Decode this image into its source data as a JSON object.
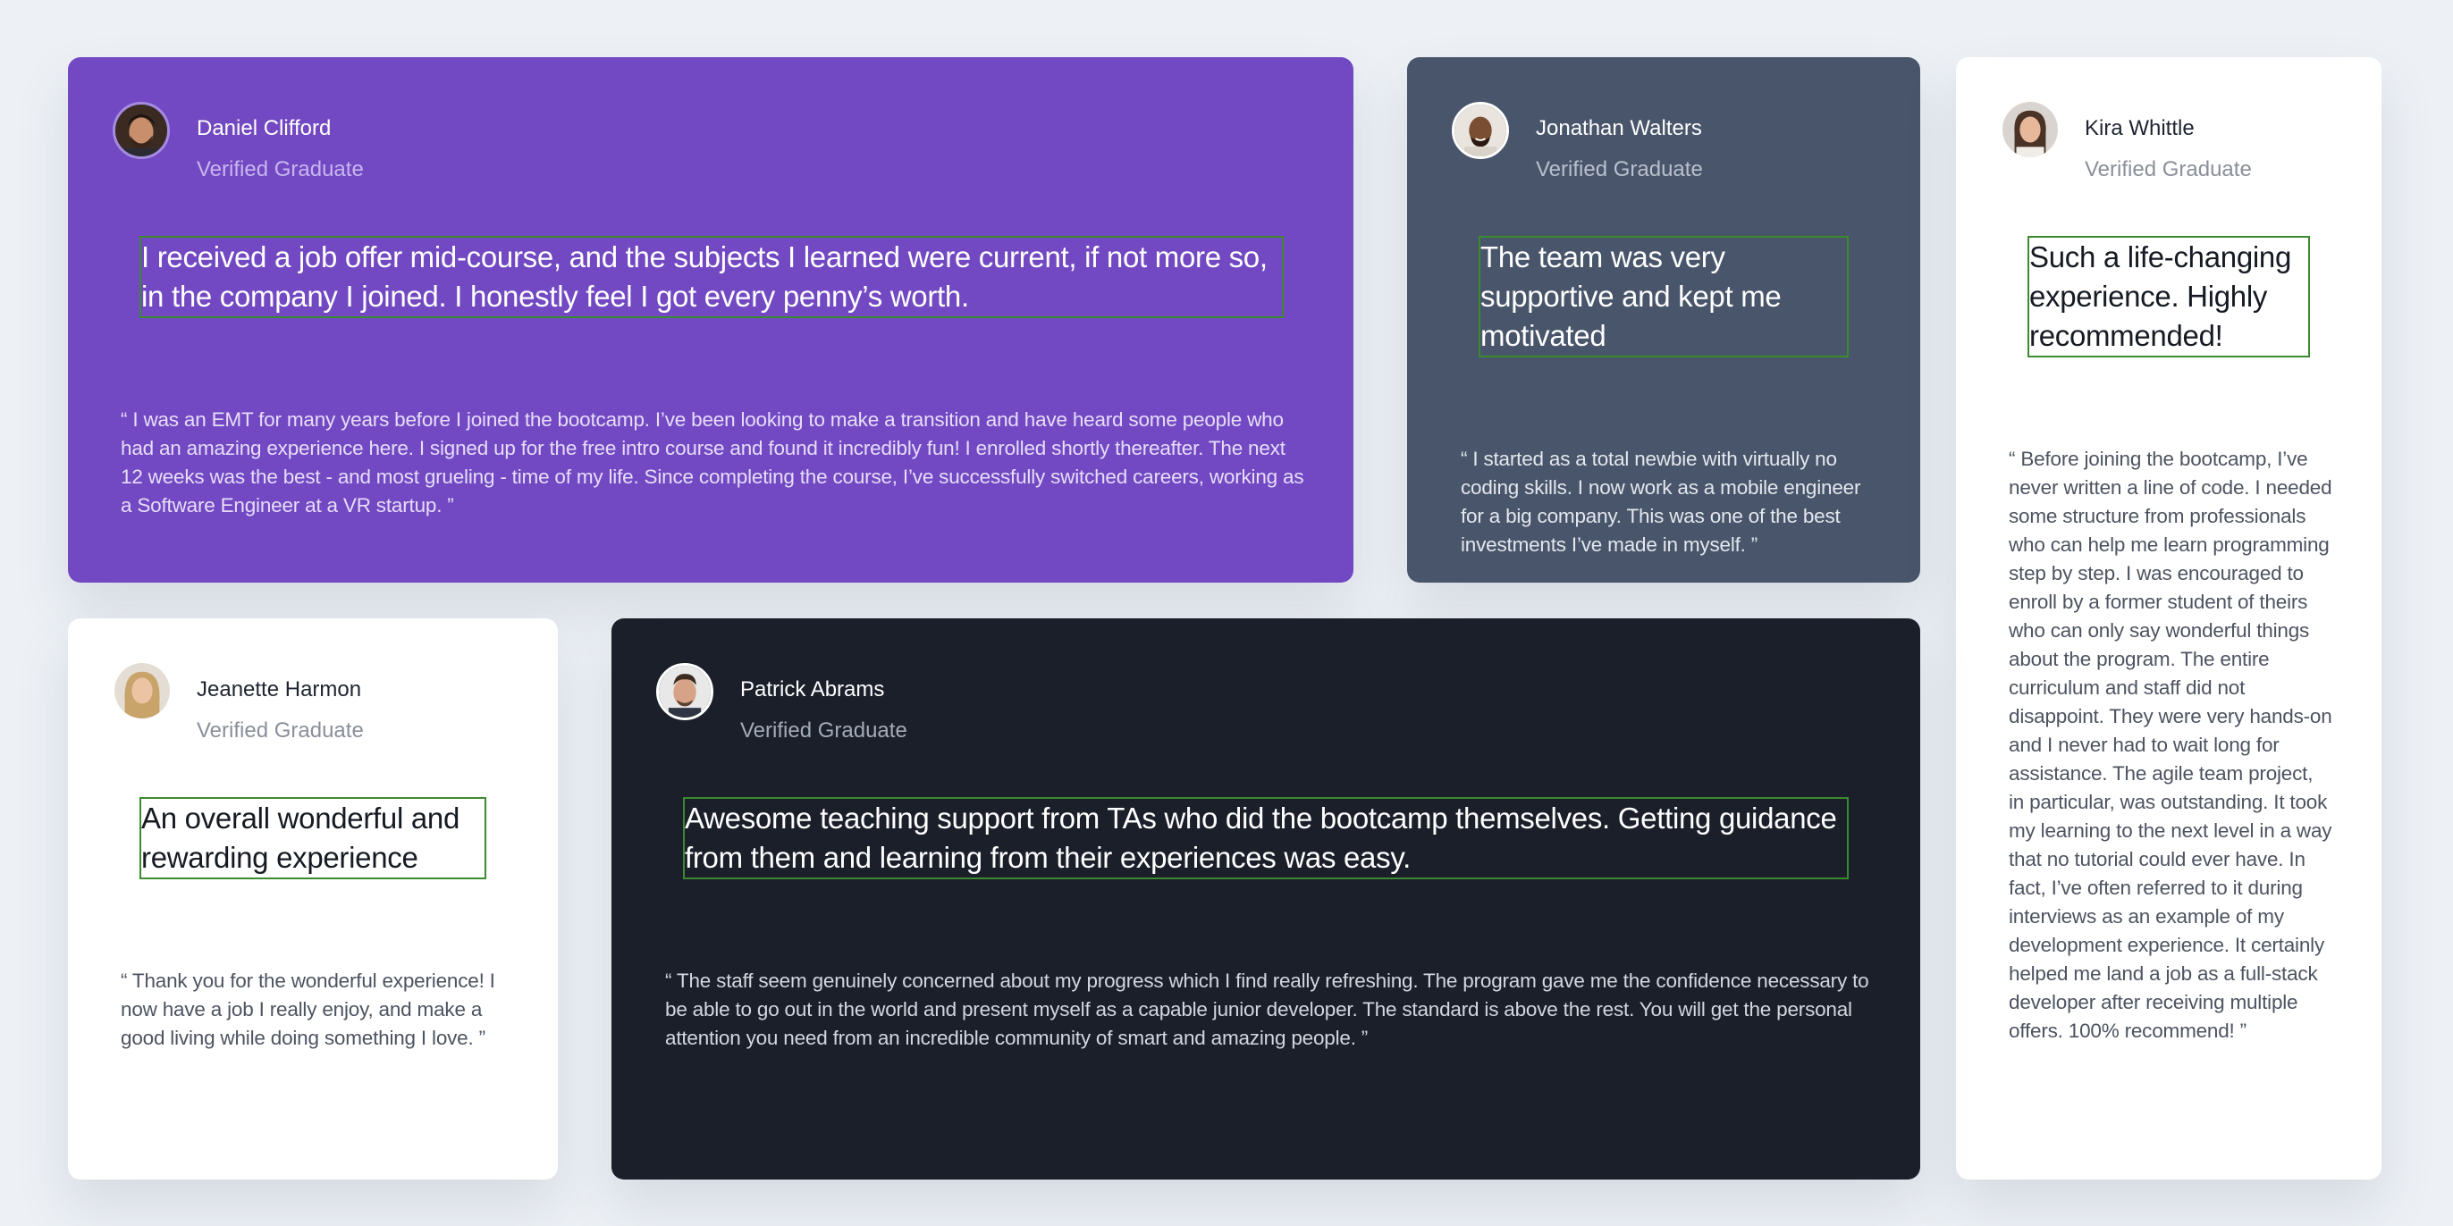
{
  "testimonials": [
    {
      "name": "Daniel Clifford",
      "status": "Verified Graduate",
      "headline": "I received a job offer mid-course, and the subjects I learned were current, if not more so, in the company I joined. I honestly feel I got every penny’s worth.",
      "quote": "“ I was an EMT for many years before I joined the bootcamp. I’ve been looking to make a transition and have heard some people who had an amazing experience here. I signed up for the free intro course and found it incredibly fun! I enrolled shortly thereafter. The next 12 weeks was the best - and most grueling - time of my life. Since completing the course, I’ve successfully switched careers, working as a Software Engineer at a VR startup. ”",
      "avatar_icon": "avatar-man-beard-icon",
      "theme_color": "#7249c2"
    },
    {
      "name": "Jonathan Walters",
      "status": "Verified Graduate",
      "headline": "The team was very supportive and kept me motivated",
      "quote": "“ I started as a total newbie with virtually no coding skills. I now work as a mobile engineer for a big company. This was one of the best investments I’ve made in myself. ”",
      "avatar_icon": "avatar-man-smiling-icon",
      "theme_color": "#48556a"
    },
    {
      "name": "Kira Whittle",
      "status": "Verified Graduate",
      "headline": "Such a life-changing experience. Highly recommended!",
      "quote": "“ Before joining the bootcamp, I’ve never written a line of code. I needed some structure from professionals who can help me learn programming step by step. I was encouraged to enroll by a former student of theirs who can only say wonderful things about the program. The entire curriculum and staff did not disappoint. They were very hands-on and I never had to wait long for assistance. The agile team project, in particular, was outstanding. It took my learning to the next level in a way that no tutorial could ever have. In fact, I’ve often referred to it during interviews as an example of my development experience. It certainly helped me land a job as a full-stack developer after receiving multiple offers. 100% recommend! ”",
      "avatar_icon": "avatar-woman-dark-hair-icon",
      "theme_color": "#ffffff"
    },
    {
      "name": "Jeanette Harmon",
      "status": "Verified Graduate",
      "headline": "An overall wonderful and rewarding experience",
      "quote": "“ Thank you for the wonderful experience! I now have a job I really enjoy, and make a good living while doing something I love. ”",
      "avatar_icon": "avatar-woman-blonde-icon",
      "theme_color": "#ffffff"
    },
    {
      "name": "Patrick Abrams",
      "status": "Verified Graduate",
      "headline": "Awesome teaching support from TAs who did the bootcamp themselves. Getting guidance from them and learning from their experiences was easy.",
      "quote": "“ The staff seem genuinely concerned about my progress which I find really refreshing. The program gave me the confidence necessary to be able to go out in the world and present myself as a capable junior developer. The standard is above the rest. You will get the personal attention you need from an incredible community of smart and amazing people. ”",
      "avatar_icon": "avatar-man-short-hair-icon",
      "theme_color": "#1a1f2a"
    }
  ]
}
